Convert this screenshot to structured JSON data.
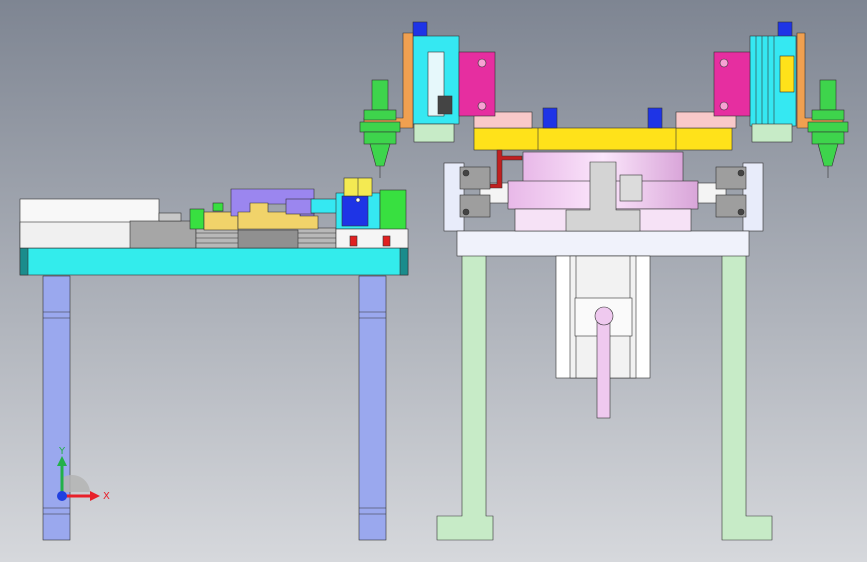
{
  "viewport": {
    "background_top": "#7e8592",
    "background_bottom": "#d6d8dc"
  },
  "triad": {
    "x_label": "X",
    "y_label": "Y",
    "x_color": "#e8202a",
    "y_color": "#22b04a",
    "z_color": "#2040e0"
  },
  "colors": {
    "table_top": "#33ecec",
    "leg_blue": "#9aa8ee",
    "leg_green": "#c7ebc7",
    "base_white": "#f0f2fb",
    "yellow": "#ffe21a",
    "tan": "#f1d36a",
    "purple": "#9b86ef",
    "pink_body": "#efc9ef",
    "magenta": "#e62ea0",
    "cyan_block": "#35e8f2",
    "blue_block": "#1e34e6",
    "green_block": "#38e040",
    "orange": "#f0a050",
    "gray": "#a6a6a6",
    "dark_gray": "#565656",
    "salmon": "#f9c9c9",
    "red": "#e02020",
    "dark_red": "#c02020",
    "nozzle_green": "#3ed44c"
  }
}
